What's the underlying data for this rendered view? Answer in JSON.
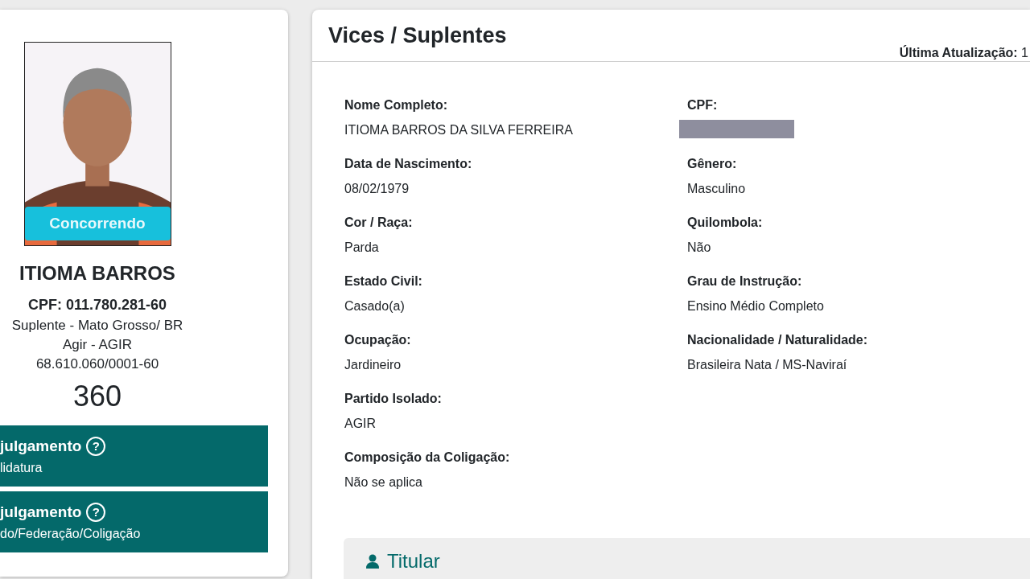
{
  "candidate": {
    "status": "Concorrendo",
    "name": "ITIOMA BARROS",
    "cpf": "CPF: 011.780.281-60",
    "lines": [
      "Suplente - Mato Grosso/ BR",
      "Agir - AGIR",
      "68.610.060/0001-60"
    ],
    "number": "360",
    "judgments": [
      {
        "title": "julgamento",
        "help": "?",
        "subtitle": "lidatura"
      },
      {
        "title": "julgamento",
        "help": "?",
        "subtitle": "do/Federação/Coligação"
      }
    ]
  },
  "panel": {
    "title": "Vices / Suplentes",
    "updated_label": "Última Atualização:",
    "updated_value": "1",
    "columns": [
      [
        {
          "label": "Nome Completo:",
          "kind": "text",
          "value": "ITIOMA BARROS DA SILVA FERREIRA"
        },
        {
          "label": "Data de Nascimento:",
          "kind": "text",
          "value": "08/02/1979"
        },
        {
          "label": "Cor / Raça:",
          "kind": "text",
          "value": "Parda"
        },
        {
          "label": "Estado Civil:",
          "kind": "text",
          "value": "Casado(a)"
        },
        {
          "label": "Ocupação:",
          "kind": "text",
          "value": "Jardineiro"
        },
        {
          "label": "Partido Isolado:",
          "kind": "text",
          "value": "AGIR"
        },
        {
          "label": "Composição da Coligação:",
          "kind": "text",
          "value": "Não se aplica"
        }
      ],
      [
        {
          "label": "CPF:",
          "kind": "redacted"
        },
        {
          "label": "Gênero:",
          "kind": "text",
          "value": "Masculino"
        },
        {
          "label": "Quilombola:",
          "kind": "text",
          "value": "Não"
        },
        {
          "label": "Grau de Instrução:",
          "kind": "text",
          "value": "Ensino Médio Completo"
        },
        {
          "label": "Nacionalidade / Naturalidade:",
          "kind": "text",
          "value": "Brasileira Nata / MS-Naviraí"
        }
      ]
    ]
  },
  "section": {
    "title": "Titular"
  }
}
